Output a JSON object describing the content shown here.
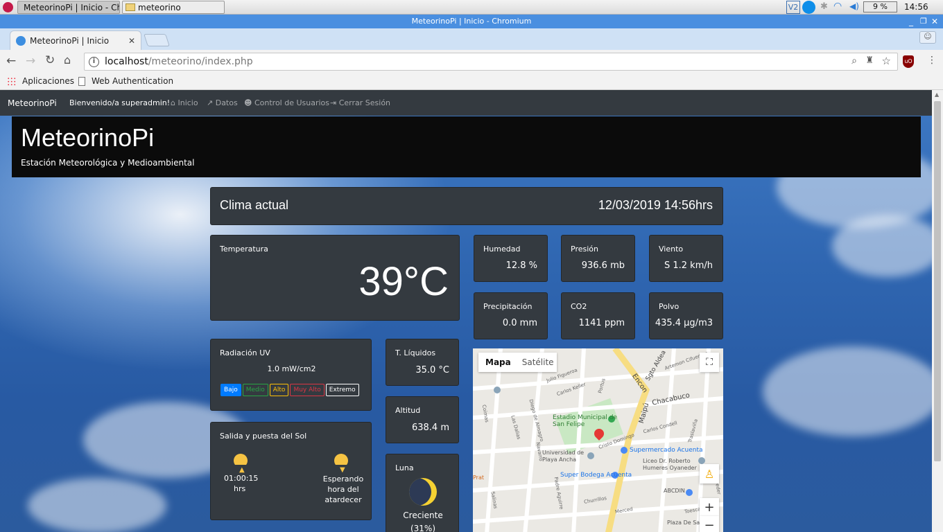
{
  "taskbar": {
    "browser_button": "MeteorinoPi | Inicio - Chr...",
    "folder_button": "meteorino",
    "battery": "9 %",
    "clock": "14:56"
  },
  "window": {
    "title": "MeteorinoPi | Inicio - Chromium"
  },
  "tabs": [
    {
      "label": "MeteorinoPi | Inicio"
    }
  ],
  "omnibox": {
    "host": "localhost",
    "path": "/meteorino/index.php"
  },
  "bookmarks": [
    "Aplicaciones",
    "Web Authentication"
  ],
  "nav": {
    "brand": "MeteorinoPi",
    "welcome": "Bienvenido/a superadmin!",
    "items": [
      "Inicio",
      "Datos",
      "Control de Usuarios",
      "Cerrar Sesión"
    ]
  },
  "header": {
    "title": "MeteorinoPi",
    "subtitle": "Estación Meteorológica y Medioambiental"
  },
  "clima": {
    "label": "Clima actual",
    "datetime": "12/03/2019 14:56hrs"
  },
  "temperatura": {
    "label": "Temperatura",
    "value": "39°C"
  },
  "stats": [
    {
      "label": "Humedad",
      "value": "12.8 %"
    },
    {
      "label": "Presión",
      "value": "936.6 mb"
    },
    {
      "label": "Viento",
      "value": "S 1.2 km/h"
    },
    {
      "label": "Precipitación",
      "value": "0.0 mm"
    },
    {
      "label": "CO2",
      "value": "1141 ppm"
    },
    {
      "label": "Polvo",
      "value": "435.4 µg/m3"
    }
  ],
  "uv": {
    "label": "Radiación UV",
    "value": "1.0 mW/cm2",
    "levels": [
      {
        "label": "Bajo",
        "color": "#007bff"
      },
      {
        "label": "Medio",
        "color": "#28a745"
      },
      {
        "label": "Alto",
        "color": "#ffc107"
      },
      {
        "label": "Muy Alto",
        "color": "#dc3545"
      },
      {
        "label": "Extremo",
        "color": "#ffffff"
      }
    ]
  },
  "liquidos": {
    "label": "T. Líquidos",
    "value": "35.0 °C"
  },
  "altitud": {
    "label": "Altitud",
    "value": "638.4 m"
  },
  "sol": {
    "label": "Salida y puesta del Sol",
    "sunrise": "01:00:15",
    "sunrise_unit": "hrs",
    "sunset": "Esperando hora del atardecer"
  },
  "luna": {
    "label": "Luna",
    "phase": "Creciente",
    "percent": "(31%)"
  },
  "map": {
    "type_map": "Mapa",
    "type_sat": "Satélite",
    "places": [
      "Estadio Municipal de San Felipe",
      "Supermercado Acuenta",
      "Universidad de Playa Ancha",
      "Liceo Dr. Roberto Humeres Oyaneder",
      "Super Bodega Acuenta",
      "ABCDIN",
      "Plaza De San"
    ],
    "streets": [
      "Chacabuco",
      "Maipú",
      "Encon",
      "Sgto Aldea",
      "Julio Figueroa",
      "Carlos Keller",
      "Artemon Cifuentes",
      "Carlos Condell",
      "Merced",
      "Churrillos",
      "Cristo Domingo",
      "Toesca",
      "Navarro",
      "Coimas",
      "Oyaneder",
      "Las Dalias",
      "Padre Aguirre",
      "Salinas",
      "Diego de Almagro",
      "Portus",
      "Traslaviña",
      "Prat"
    ]
  }
}
